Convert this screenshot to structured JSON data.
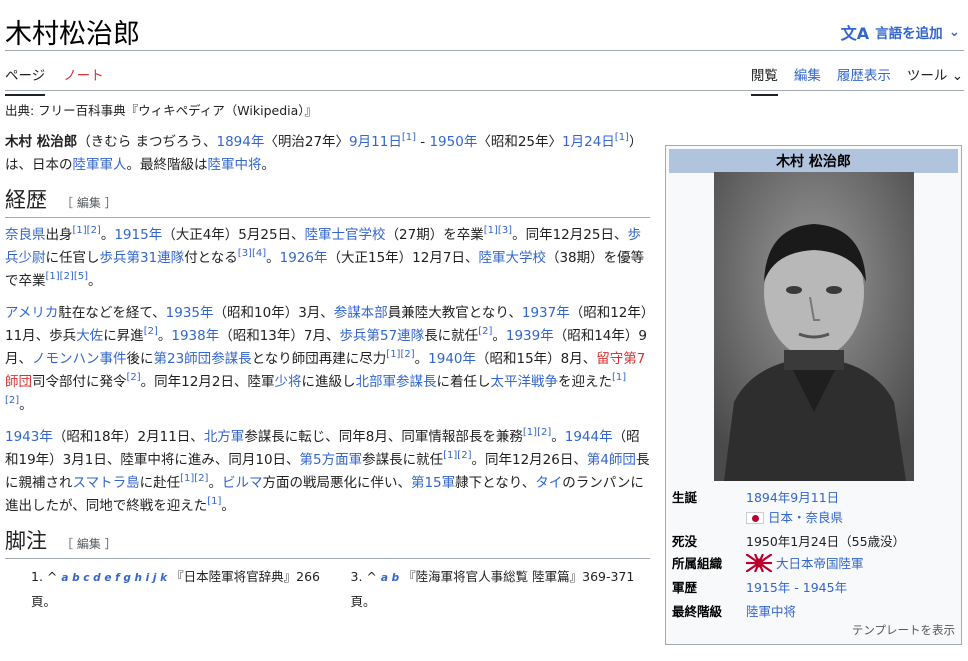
{
  "header": {
    "title": "木村松治郎",
    "language_button": "言語を追加",
    "language_icon": "translate-icon",
    "chevron_icon": "chevron-down-icon"
  },
  "tabs": {
    "left": [
      "ページ",
      "ノート"
    ],
    "right": [
      "閲覧",
      "編集",
      "履歴表示",
      "ツール"
    ]
  },
  "source_line": "出典: フリー百科事典『ウィキペディア（Wikipedia）』",
  "intro": {
    "name": "木村 松治郎",
    "reading": "（きむら まつぢろう、",
    "birth_year": "1894年",
    "birth_era": "〈明治27年〉",
    "birth_date": "9月11日",
    "ref1": "[1]",
    "dash": " - ",
    "death_year": "1950年",
    "death_era": "〈昭和25年〉",
    "death_date": "1月24日",
    "ref2": "[1]",
    "after1": "）は、日本の",
    "army_person": "陸軍軍人",
    "after2": "。最終階級は",
    "final_rank": "陸軍中将",
    "after3": "。"
  },
  "sections": [
    {
      "heading": "経歴",
      "edit": "［ 編集 ］"
    },
    {
      "heading": "脚注",
      "edit": "［ 編集 ］"
    }
  ],
  "career": {
    "p1": [
      {
        "t": "奈良県",
        "link": true
      },
      {
        "t": "出身"
      },
      {
        "t": "[1][2]",
        "sup": true
      },
      {
        "t": "。"
      },
      {
        "t": "1915年",
        "link": true
      },
      {
        "t": "（大正4年）5月25日、"
      },
      {
        "t": "陸軍士官学校",
        "link": true
      },
      {
        "t": "（27期）を卒業"
      },
      {
        "t": "[1][3]",
        "sup": true
      },
      {
        "t": "。同年12月25日、"
      },
      {
        "t": "歩兵少尉",
        "link": true
      },
      {
        "t": "に任官し"
      },
      {
        "t": "歩兵第31連隊",
        "link": true
      },
      {
        "t": "付となる"
      },
      {
        "t": "[3][4]",
        "sup": true
      },
      {
        "t": "。"
      },
      {
        "t": "1926年",
        "link": true
      },
      {
        "t": "（大正15年）12月7日、"
      },
      {
        "t": "陸軍大学校",
        "link": true
      },
      {
        "t": "（38期）を優等で卒業"
      },
      {
        "t": "[1][2][5]",
        "sup": true
      },
      {
        "t": "。"
      }
    ],
    "p2": [
      {
        "t": "アメリカ",
        "link": true
      },
      {
        "t": "駐在などを経て、"
      },
      {
        "t": "1935年",
        "link": true
      },
      {
        "t": "（昭和10年）3月、"
      },
      {
        "t": "参謀本部",
        "link": true
      },
      {
        "t": "員兼陸大教官となり、"
      },
      {
        "t": "1937年",
        "link": true
      },
      {
        "t": "（昭和12年）11月、歩兵"
      },
      {
        "t": "大佐",
        "link": true
      },
      {
        "t": "に昇進"
      },
      {
        "t": "[2]",
        "sup": true
      },
      {
        "t": "。"
      },
      {
        "t": "1938年",
        "link": true
      },
      {
        "t": "（昭和13年）7月、"
      },
      {
        "t": "歩兵第57連隊",
        "link": true
      },
      {
        "t": "長に就任"
      },
      {
        "t": "[2]",
        "sup": true
      },
      {
        "t": "。"
      },
      {
        "t": "1939年",
        "link": true
      },
      {
        "t": "（昭和14年）9月、"
      },
      {
        "t": "ノモンハン事件",
        "link": true
      },
      {
        "t": "後に"
      },
      {
        "t": "第23師団",
        "link": true
      },
      {
        "t": "参謀長",
        "link": true
      },
      {
        "t": "となり師団再建に尽力"
      },
      {
        "t": "[1][2]",
        "sup": true
      },
      {
        "t": "。"
      },
      {
        "t": "1940年",
        "link": true
      },
      {
        "t": "（昭和15年）8月、"
      },
      {
        "t": "留守第7師団",
        "red": true
      },
      {
        "t": "司令部付に発令"
      },
      {
        "t": "[2]",
        "sup": true
      },
      {
        "t": "。同年12月2日、陸軍"
      },
      {
        "t": "少将",
        "link": true
      },
      {
        "t": "に進級し"
      },
      {
        "t": "北部軍",
        "link": true
      },
      {
        "t": "参謀長",
        "link": true
      },
      {
        "t": "に着任し"
      },
      {
        "t": "太平洋戦争",
        "link": true
      },
      {
        "t": "を迎えた"
      },
      {
        "t": "[1][2]",
        "sup": true
      },
      {
        "t": "。"
      }
    ],
    "p3": [
      {
        "t": "1943年",
        "link": true
      },
      {
        "t": "（昭和18年）2月11日、"
      },
      {
        "t": "北方軍",
        "link": true
      },
      {
        "t": "参謀長に転じ、同年8月、同軍情報部長を兼務"
      },
      {
        "t": "[1][2]",
        "sup": true
      },
      {
        "t": "。"
      },
      {
        "t": "1944年",
        "link": true
      },
      {
        "t": "（昭和19年）3月1日、陸軍中将に進み、同月10日、"
      },
      {
        "t": "第5方面軍",
        "link": true
      },
      {
        "t": "参謀長に就任"
      },
      {
        "t": "[1][2]",
        "sup": true
      },
      {
        "t": "。同年12月26日、"
      },
      {
        "t": "第4師団",
        "link": true
      },
      {
        "t": "長に親補され"
      },
      {
        "t": "スマトラ島",
        "link": true
      },
      {
        "t": "に赴任"
      },
      {
        "t": "[1][2]",
        "sup": true
      },
      {
        "t": "。"
      },
      {
        "t": "ビルマ",
        "link": true
      },
      {
        "t": "方面の戦局悪化に伴い、"
      },
      {
        "t": "第15軍",
        "link": true
      },
      {
        "t": "隷下となり、"
      },
      {
        "t": "タイ",
        "link": true
      },
      {
        "t": "のランパンに進出したが、同地で終戦を迎えた"
      },
      {
        "t": "[1]",
        "sup": true
      },
      {
        "t": "。"
      }
    ]
  },
  "footnotes": [
    {
      "num": "1.",
      "caret": "^",
      "letters": "a b c d e f g h i j k",
      "text": "『日本陸軍将官辞典』266頁。"
    },
    {
      "num": "3.",
      "caret": "^",
      "letters": "a b",
      "text": "『陸海軍将官人事総覧 陸軍篇』369-371頁。"
    }
  ],
  "infobox": {
    "title": "木村 松治郎",
    "rows": [
      {
        "label": "生誕",
        "value": "1894年9月11日"
      },
      {
        "label": "",
        "value": "日本・奈良県",
        "flag": "japan-flag-icon"
      },
      {
        "label": "死没",
        "value": "1950年1月24日（55歳没）"
      },
      {
        "label": "所属組織",
        "value": "大日本帝国陸軍",
        "flag": "rising-sun-flag-icon"
      },
      {
        "label": "軍歴",
        "value": "1915年 - 1945年"
      },
      {
        "label": "最終階級",
        "value": "陸軍中将"
      }
    ],
    "footer": "テンプレートを表示"
  },
  "colors": {
    "link": "#3366cc",
    "redlink": "#d73333",
    "infobox_title_bg": "#b0c4de",
    "border": "#a2a9b1"
  }
}
